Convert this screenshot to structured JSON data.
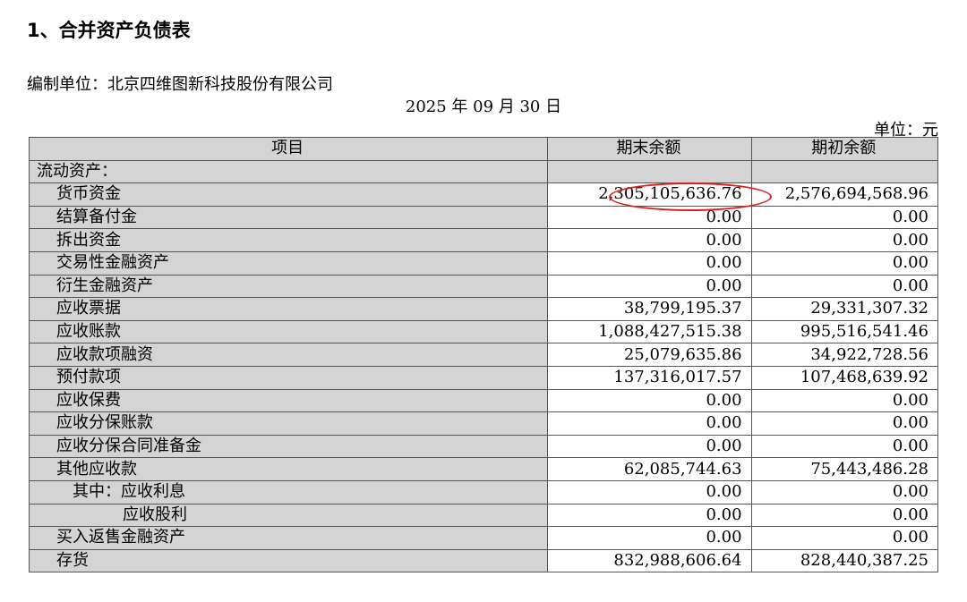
{
  "heading": "1、合并资产负债表",
  "prepared_by": "编制单位：北京四维图新科技股份有限公司",
  "report_date": "2025 年 09 月 30 日",
  "currency_unit": "单位：元",
  "columns": {
    "item": "项目",
    "period_end": "期末余额",
    "period_begin": "期初余额"
  },
  "section": "流动资产：",
  "rows": [
    {
      "item": "货币资金",
      "end": "2,305,105,636.76",
      "begin": "2,576,694,568.96"
    },
    {
      "item": "结算备付金",
      "end": "0.00",
      "begin": "0.00"
    },
    {
      "item": "拆出资金",
      "end": "0.00",
      "begin": "0.00"
    },
    {
      "item": "交易性金融资产",
      "end": "0.00",
      "begin": "0.00"
    },
    {
      "item": "衍生金融资产",
      "end": "0.00",
      "begin": "0.00"
    },
    {
      "item": "应收票据",
      "end": "38,799,195.37",
      "begin": "29,331,307.32"
    },
    {
      "item": "应收账款",
      "end": "1,088,427,515.38",
      "begin": "995,516,541.46"
    },
    {
      "item": "应收款项融资",
      "end": "25,079,635.86",
      "begin": "34,922,728.56"
    },
    {
      "item": "预付款项",
      "end": "137,316,017.57",
      "begin": "107,468,639.92"
    },
    {
      "item": "应收保费",
      "end": "0.00",
      "begin": "0.00"
    },
    {
      "item": "应收分保账款",
      "end": "0.00",
      "begin": "0.00"
    },
    {
      "item": "应收分保合同准备金",
      "end": "0.00",
      "begin": "0.00"
    },
    {
      "item": "其他应收款",
      "end": "62,085,744.63",
      "begin": "75,443,486.28"
    },
    {
      "item": "其中：应收利息",
      "end": "0.00",
      "begin": "0.00"
    },
    {
      "item": "应收股利",
      "end": "0.00",
      "begin": "0.00"
    },
    {
      "item": "买入返售金融资产",
      "end": "0.00",
      "begin": "0.00"
    },
    {
      "item": "存货",
      "end": "832,988,606.64",
      "begin": "828,440,387.25"
    }
  ],
  "highlight_color": "#e02020"
}
